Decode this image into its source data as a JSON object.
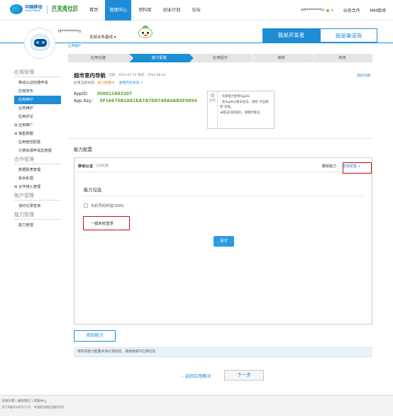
{
  "brand": {
    "logo_cn": "中国移动",
    "logo_en": "China Mobile",
    "community_cn": "开发者社区",
    "community_en": "DEVELOPER NETWORK"
  },
  "nav": {
    "items": [
      {
        "label": "首页",
        "active": false
      },
      {
        "label": "管理中心",
        "active": true
      },
      {
        "label": "资料库",
        "active": false
      },
      {
        "label": "创业计划",
        "active": false
      },
      {
        "label": "论坛",
        "active": false
      }
    ],
    "user": "H********n",
    "biz": "业务合作",
    "mm": "MM商场"
  },
  "profile": {
    "username": "H********n",
    "business": "全部业务基线"
  },
  "role_tabs": [
    "我是开发者",
    "我是渠道商"
  ],
  "crumb": "应用维护",
  "steps": [
    {
      "label": "应用创建",
      "active": false
    },
    {
      "label": "能力配置",
      "active": true
    },
    {
      "label": "应用提交",
      "active": false
    },
    {
      "label": "审核",
      "active": false
    },
    {
      "label": "商用",
      "active": false
    }
  ],
  "sidebar": [
    {
      "type": "head",
      "label": "应用管理"
    },
    {
      "type": "item",
      "label": "移动认证快捷申请"
    },
    {
      "type": "item",
      "label": "应用发布"
    },
    {
      "type": "item",
      "label": "应用维护",
      "active": true
    },
    {
      "type": "item",
      "label": "业务维护"
    },
    {
      "type": "item",
      "label": "应用评论"
    },
    {
      "type": "plus",
      "label": "⊞ 应用推广"
    },
    {
      "type": "plus",
      "label": "⊞ 销售数据"
    },
    {
      "type": "item",
      "label": "应用管控配置"
    },
    {
      "type": "item",
      "label": "计费资源申请及管理"
    },
    {
      "type": "head",
      "label": "合作管理"
    },
    {
      "type": "item",
      "label": "数据报表管理"
    },
    {
      "type": "item",
      "label": "投诉处理"
    },
    {
      "type": "plus",
      "label": "⊞ 合作接入管理"
    },
    {
      "type": "head",
      "label": "账户管理"
    },
    {
      "type": "item",
      "label": "违约记录查询"
    },
    {
      "type": "head",
      "label": "能力管理"
    },
    {
      "type": "item",
      "label": "能力管理"
    }
  ],
  "app": {
    "name": "超市室内导航",
    "meta": "创建：2018-07-19    更新：2018-08-24",
    "status_prefix": "应用当前状态：",
    "status": "能力配置中",
    "history": "查看历史状态 >",
    "id_label": "AppID：",
    "id_value": "300011863207",
    "key_label": "App Key：",
    "key_value": "5F16675B2A81EA7A7D8748A0AB5F0854",
    "my_question": "我的问题"
  },
  "tip": {
    "side": "注意",
    "lines": [
      "· 有部能力使用AppID。",
      "· 若AppKey暂未生成，请按“点击刷新”获取，",
      "  未能成功获取的，请稍后重试。"
    ]
  },
  "ability": {
    "section_title": "能力配置",
    "name": "移动认证",
    "state": "已经配置",
    "delete": "删除能力",
    "view_config": "查看配置 ∧",
    "inner_title": "能力勾选",
    "opt1": "本机号码校验(SDK)",
    "opt2": "一键免密登录",
    "submit": "提交"
  },
  "add_ability": "添加能力",
  "note": "待完成能力配置并通过调测后，请继续填写应用信息",
  "back": "返回应用概况",
  "next": "下一步",
  "footer": {
    "links": "法律声明 | 联系我们 | 帮助中心",
    "icp": "京ICP备05002571号 · 中国移动通信版权所有"
  }
}
